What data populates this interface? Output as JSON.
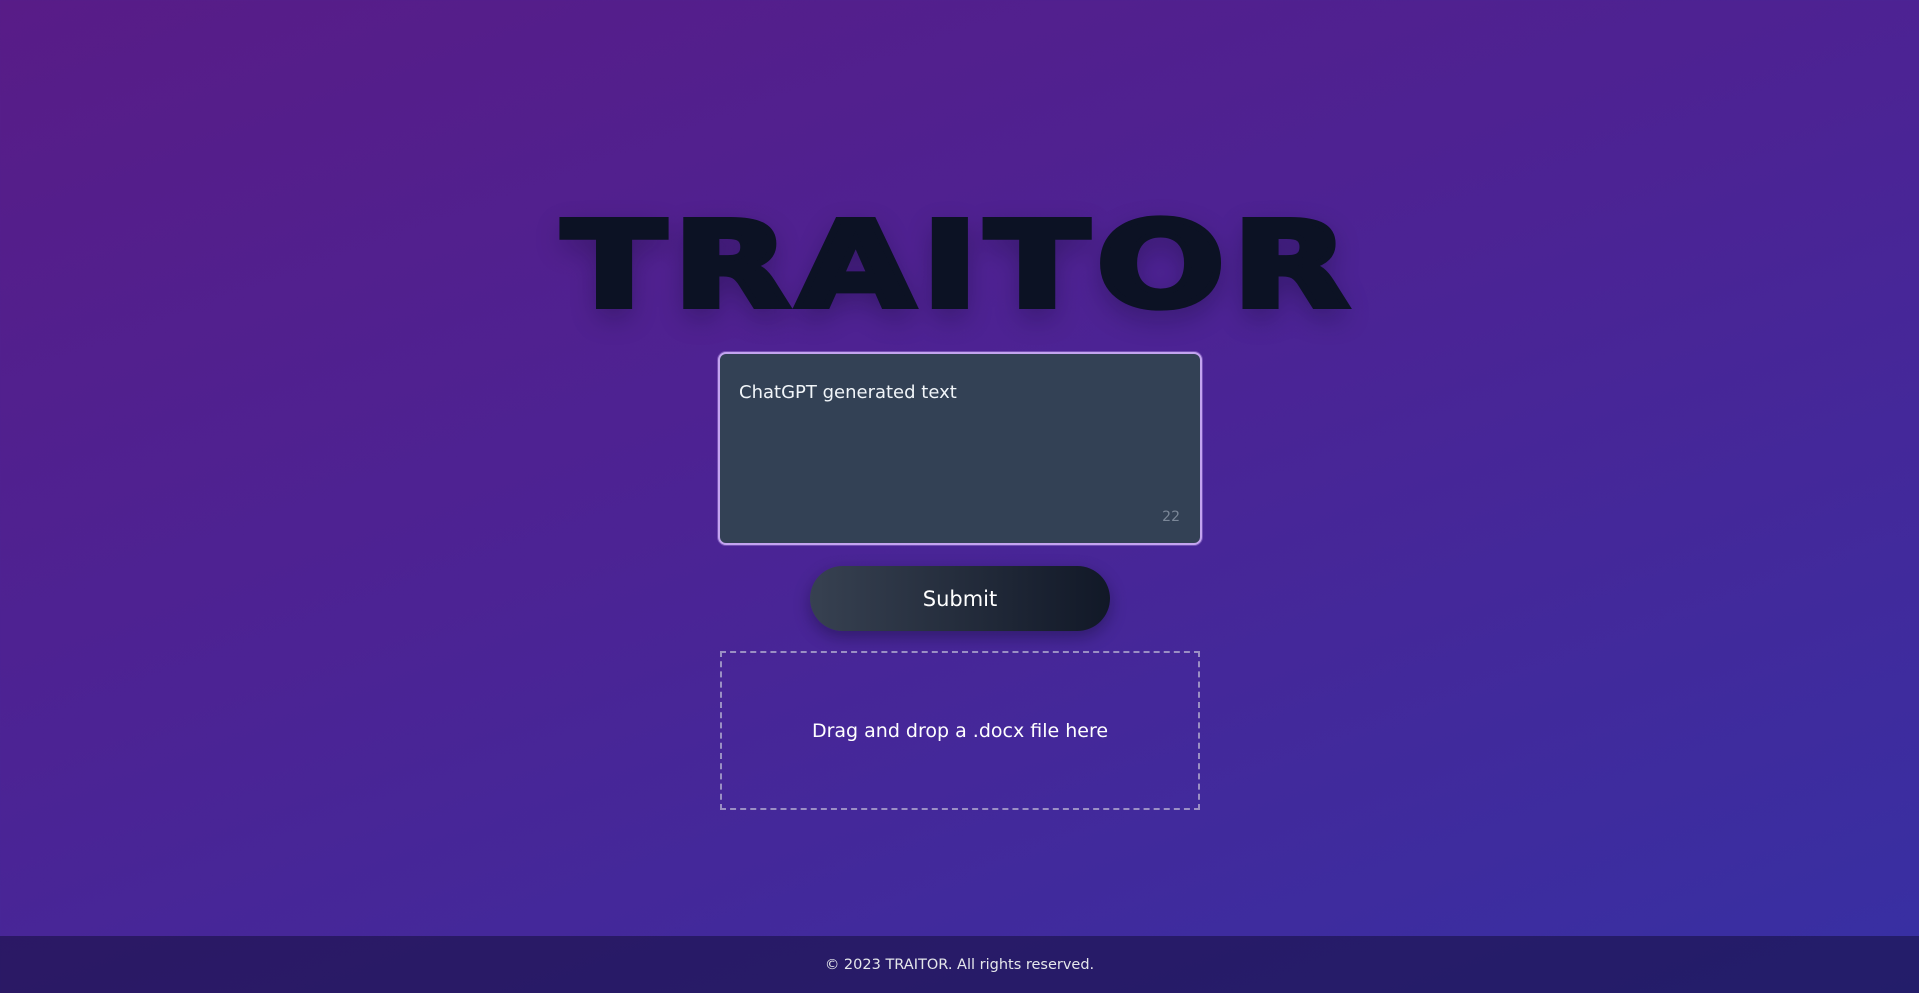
{
  "header": {
    "logo_text": "TRAITOR"
  },
  "editor": {
    "value": "ChatGPT generated text",
    "char_count": "22"
  },
  "actions": {
    "submit_label": "Submit"
  },
  "upload": {
    "drop_label": "Drag and drop a .docx file here"
  },
  "footer": {
    "copyright": "© 2023 TRAITOR. All rights reserved."
  },
  "colors": {
    "background_start": "#581c87",
    "background_end": "#3730a3",
    "textarea_bg": "#334155",
    "textarea_border": "#c4a4f0",
    "logo": "#0c1224"
  }
}
